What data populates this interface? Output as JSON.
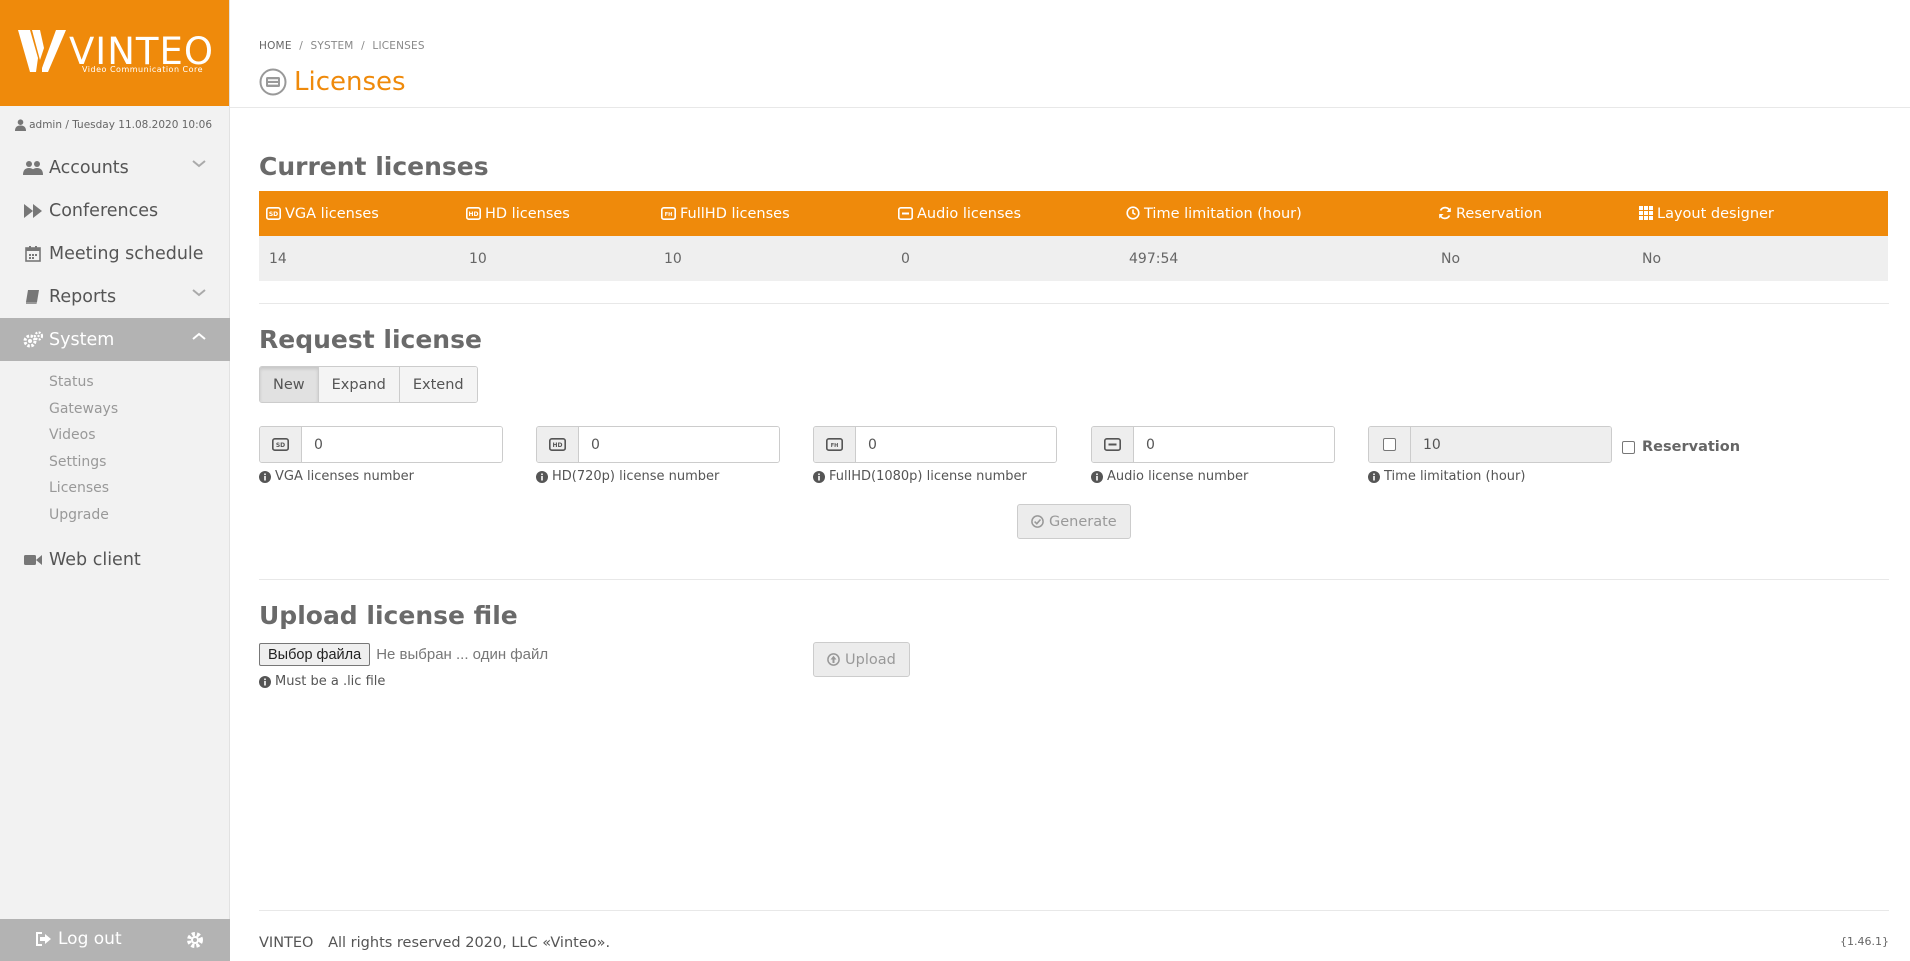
{
  "brand": {
    "name": "VINTEO",
    "tagline": "Video Communication Core"
  },
  "user_info": "admin / Tuesday 11.08.2020 10:06",
  "sidebar": {
    "items": [
      {
        "label": "Accounts",
        "icon": "users-icon"
      },
      {
        "label": "Conferences",
        "icon": "fast-forward-icon"
      },
      {
        "label": "Meeting schedule",
        "icon": "calendar-icon"
      },
      {
        "label": "Reports",
        "icon": "book-icon"
      },
      {
        "label": "System",
        "icon": "cogs-icon"
      },
      {
        "label": "Web client",
        "icon": "video-camera-icon"
      }
    ],
    "system_sub": [
      "Status",
      "Gateways",
      "Videos",
      "Settings",
      "Licenses",
      "Upgrade"
    ],
    "logout": "Log out"
  },
  "breadcrumb": {
    "home": "HOME",
    "section": "SYSTEM",
    "page": "LICENSES"
  },
  "page_title": "Licenses",
  "current": {
    "title": "Current licenses",
    "headers": [
      "VGA licenses",
      "HD licenses",
      "FullHD licenses",
      "Audio licenses",
      "Time limitation (hour)",
      "Reservation",
      "Layout designer"
    ],
    "values": [
      "14",
      "10",
      "10",
      "0",
      "497:54",
      "No",
      "No"
    ]
  },
  "request": {
    "title": "Request license",
    "tabs": [
      "New",
      "Expand",
      "Extend"
    ],
    "active_tab": "New",
    "fields": [
      {
        "value": "0",
        "help": "VGA licenses number"
      },
      {
        "value": "0",
        "help": "HD(720p) license number"
      },
      {
        "value": "0",
        "help": "FullHD(1080p) license number"
      },
      {
        "value": "0",
        "help": "Audio license number"
      },
      {
        "value": "10",
        "help": "Time limitation (hour)"
      }
    ],
    "reservation_label": "Reservation",
    "generate": "Generate"
  },
  "upload": {
    "title": "Upload license file",
    "choose_button": "Выбор файла",
    "no_file": "Не выбран ... один файл",
    "help": "Must be a .lic file",
    "upload_button": "Upload"
  },
  "footer": {
    "brand": "VINTEO",
    "copyright": "All rights reserved 2020, LLC «Vinteo».",
    "version": "{1.46.1}"
  },
  "colors": {
    "accent": "#ef8a0b",
    "sidebar_bg": "#f2f2f2",
    "active_nav": "#b3b3b3"
  }
}
